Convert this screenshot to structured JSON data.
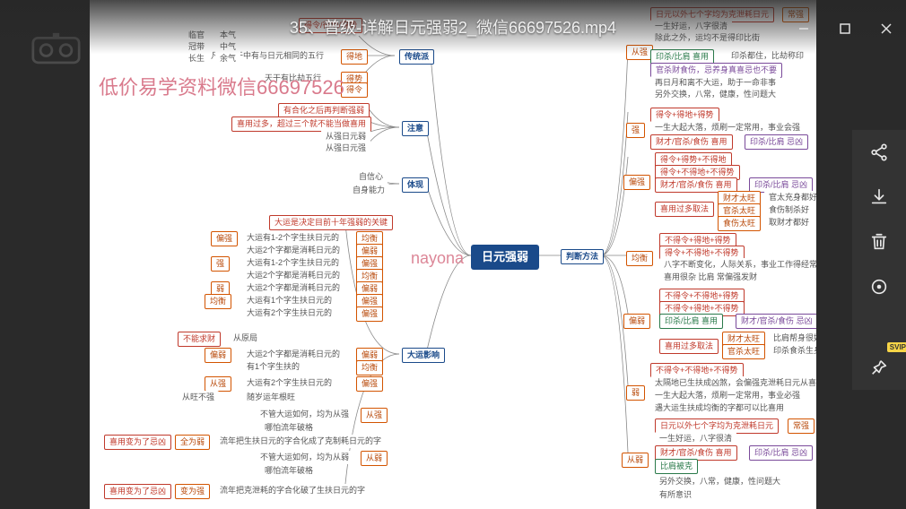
{
  "window": {
    "title": "35、普级-详解日元强弱2_微信66697526.mp4"
  },
  "watermarks": {
    "left": "低价易学资料微信66697526",
    "center": "nayona"
  },
  "toolbar": {
    "svip": "SVIP"
  },
  "mindmap": {
    "center": "日元强弱",
    "left_branches": {
      "traditional": {
        "hub": "传统派",
        "items": [
          {
            "label": "得地",
            "note": "凡支藏干中有与日元相同的五行"
          },
          {
            "label": "得势",
            "note": "天干有比劫五行"
          },
          {
            "label": "得令"
          }
        ],
        "top_sub": [
          {
            "k": "临官",
            "v": "本气"
          },
          {
            "k": "冠带",
            "v": "中气"
          },
          {
            "k": "长生",
            "v": "余气"
          }
        ],
        "top_left": "得令/得地/得势"
      },
      "attention": {
        "hub": "注意",
        "items": [
          "有合化之后再判断强弱",
          "喜用过多，超过三个就不能当做喜用",
          "从强日元弱",
          "从强日元强"
        ]
      },
      "tixian": {
        "hub": "体现",
        "items": [
          "自信心",
          "自身能力"
        ]
      },
      "dayun": {
        "hub": "大运影响",
        "title": "大运是决定目前十年强弱的关键",
        "groups": [
          {
            "tag": "偏强",
            "lines": [
              "大运有1-2个字生扶日元的"
            ],
            "res": "均衡"
          },
          {
            "tag": "偏强",
            "lines": [
              "大运2个字都是消耗日元的"
            ],
            "res": "偏弱"
          },
          {
            "tag": "强",
            "lines": [
              "大运有1-2个字生扶日元的"
            ],
            "res": "偏强"
          },
          {
            "tag": "强",
            "lines": [
              "大运2个字都是消耗日元的"
            ],
            "res": "均衡"
          },
          {
            "tag": "弱",
            "lines": [
              "大运2个字都是消耗日元的"
            ],
            "res": "偏弱"
          },
          {
            "tag": "均衡",
            "lines": [
              "大运有1个字生扶日元的"
            ],
            "res": "偏强"
          },
          {
            "tag": "均衡",
            "lines": [
              "大运有2个字生扶日元的"
            ],
            "res": "偏强"
          },
          {
            "tag": "不能求财",
            "lines": [
              "从原局"
            ],
            "res": ""
          },
          {
            "tag": "偏弱",
            "lines": [
              "大运2个字都是消耗日元的"
            ],
            "res": "偏弱"
          },
          {
            "tag": "偏弱",
            "lines": [
              "有1个字生扶的"
            ],
            "res": "均衡"
          },
          {
            "tag": "从强",
            "lines": [
              "大运有2个字生扶日元的"
            ],
            "res": "偏强"
          },
          {
            "tag": "从旺不强",
            "lines": [
              "随岁运年根旺"
            ],
            "res": ""
          }
        ],
        "b1": {
          "head": "不管大运如何，均为从强",
          "tag": "从强"
        },
        "b2": {
          "head": "流年把生扶日元的字合化成了克制耗日元的字",
          "tag": "全为弱",
          "pre": "喜用变为了忌凶"
        },
        "b3": {
          "head": "不管大运如何，均为从弱",
          "tag": "从弱"
        },
        "b4": {
          "head": "哪怕流年破格",
          "tag": ""
        },
        "b5": {
          "head": "流年把克泄耗的字合化破了生扶日元的字",
          "tag": "变为强",
          "pre": "喜用变为了忌凶"
        }
      }
    },
    "right_branches": {
      "method_hub": "判断方法",
      "cong_qiang": {
        "tag": "从强",
        "lines": [
          {
            "l": "日元以外七个字均为克泄耗日元",
            "r": "常强"
          },
          {
            "l": "一生好运，八字很清"
          },
          {
            "l": "除此之外，运均不是得印比街"
          },
          {
            "l": "印杀/比肩 喜用",
            "r": "印杀都住，比劫称印"
          },
          {
            "l": "官杀财食伤，忌养身真喜忌也不要"
          },
          {
            "l": "再日月和离不大运，助于一命非事"
          },
          {
            "l": "另外交换，八常，健康，性问题大"
          }
        ]
      },
      "qiang": {
        "tag": "强",
        "lines": [
          {
            "l": "得令+得地+得势"
          },
          {
            "l": "一生大起大落，烦刷一定常用，事业会强"
          },
          {
            "l": "财才/官杀/食伤 喜用",
            "r": "印杀/比肩 忌凶"
          }
        ]
      },
      "pian_qiang": {
        "tag": "偏强",
        "lines": [
          {
            "l": "得令+得势+不得地"
          },
          {
            "l": "得令+不得地+不得势"
          },
          {
            "l": "财才/官杀/食伤 喜用",
            "r": "印杀/比肩 忌凶"
          }
        ],
        "sub": [
          {
            "l": "财才太旺",
            "r": "官太充身都好"
          },
          {
            "l": "官杀太旺",
            "r": "食伤制杀好"
          },
          {
            "l": "食伤太旺",
            "r": "取财才都好"
          }
        ],
        "subhead": "喜用过多取法"
      },
      "jun_heng": {
        "tag": "均衡",
        "lines": [
          {
            "l": "不得令+得地+得势"
          },
          {
            "l": "得令+不得地+不得势"
          },
          {
            "l": "八字不断变化，人际关系，事业工作得经常变"
          },
          {
            "l": "喜用很杂 比肩 常偏强发财"
          }
        ]
      },
      "pian_ruo": {
        "tag": "偏弱",
        "lines": [
          {
            "l": "不得令+不得地+得势"
          },
          {
            "l": "不得令+得地+不得势"
          },
          {
            "l": "印杀/比肩 喜用",
            "r": "财才/官杀/食伤 忌凶"
          }
        ],
        "sub": [
          {
            "l": "财才太旺",
            "r": "比肩帮身很好"
          },
          {
            "l": "官杀太旺",
            "r": "印杀食杀生身"
          }
        ],
        "subhead": "喜用过多取法"
      },
      "ruo": {
        "tag": "弱",
        "lines": [
          {
            "l": "不得令+不得地+不得势"
          },
          {
            "l": "太隔地已生扶成凶煞，会偏强克泄耗日元从喜"
          },
          {
            "l": "一生大起大落，烦刷一定常用，事业必强"
          },
          {
            "l": "遇大运生扶成均衡的字都可以比喜用"
          }
        ]
      },
      "cong_ruo": {
        "tag": "从弱",
        "lines": [
          {
            "l": "日元以外七个字均为克泄耗日元",
            "r": "常强"
          },
          {
            "l": "一生好运，八字很清"
          },
          {
            "l": "财才/官杀/食伤 喜用",
            "r": "印杀/比肩 忌凶"
          },
          {
            "l": "比肩被克"
          },
          {
            "l": "另外交换，八常，健康，性问题大"
          },
          {
            "l": "有所意识"
          }
        ]
      }
    }
  }
}
